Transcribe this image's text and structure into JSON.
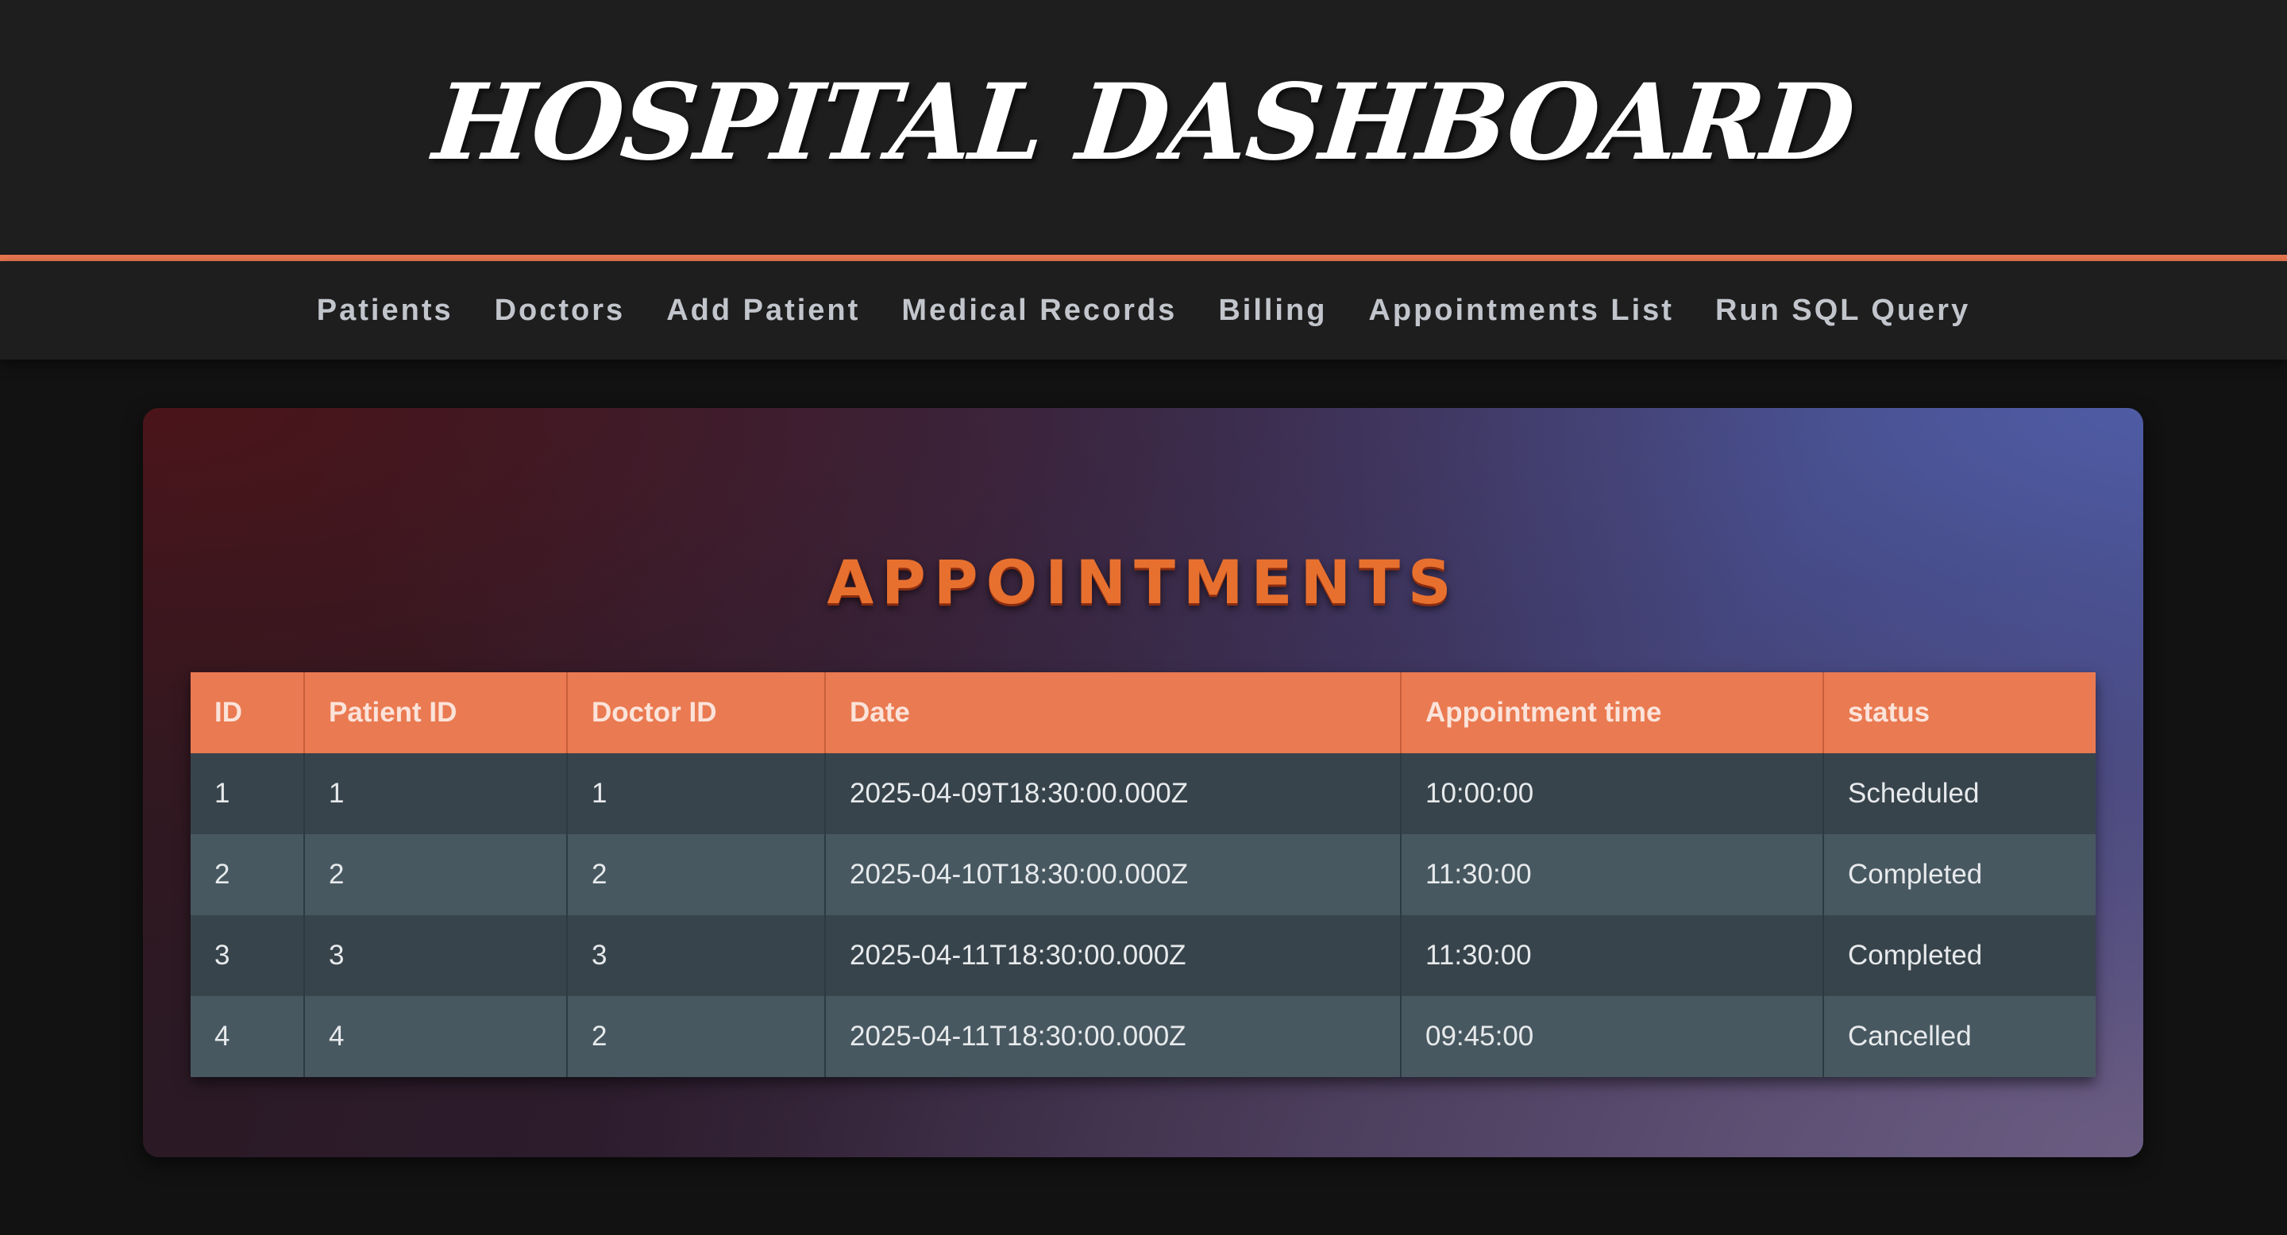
{
  "header": {
    "title": "HOSPITAL DASHBOARD"
  },
  "nav": {
    "items": [
      {
        "label": "Patients"
      },
      {
        "label": "Doctors"
      },
      {
        "label": "Add Patient"
      },
      {
        "label": "Medical Records"
      },
      {
        "label": "Billing"
      },
      {
        "label": "Appointments List"
      },
      {
        "label": "Run SQL Query"
      }
    ]
  },
  "appointments": {
    "title": "APPOINTMENTS",
    "columns": [
      "ID",
      "Patient ID",
      "Doctor ID",
      "Date",
      "Appointment time",
      "status"
    ],
    "rows": [
      [
        "1",
        "1",
        "1",
        "2025-04-09T18:30:00.000Z",
        "10:00:00",
        "Scheduled"
      ],
      [
        "2",
        "2",
        "2",
        "2025-04-10T18:30:00.000Z",
        "11:30:00",
        "Completed"
      ],
      [
        "3",
        "3",
        "3",
        "2025-04-11T18:30:00.000Z",
        "11:30:00",
        "Completed"
      ],
      [
        "4",
        "4",
        "2",
        "2025-04-11T18:30:00.000Z",
        "09:45:00",
        "Cancelled"
      ]
    ]
  },
  "colors": {
    "accent": "#e8774f",
    "header_bg": "#1e1e1e",
    "page_bg": "#121212",
    "table_header_bg": "#ea7a51",
    "row_odd_bg": "#38444c",
    "row_even_bg": "#485861",
    "title_orange": "#e7702f"
  }
}
